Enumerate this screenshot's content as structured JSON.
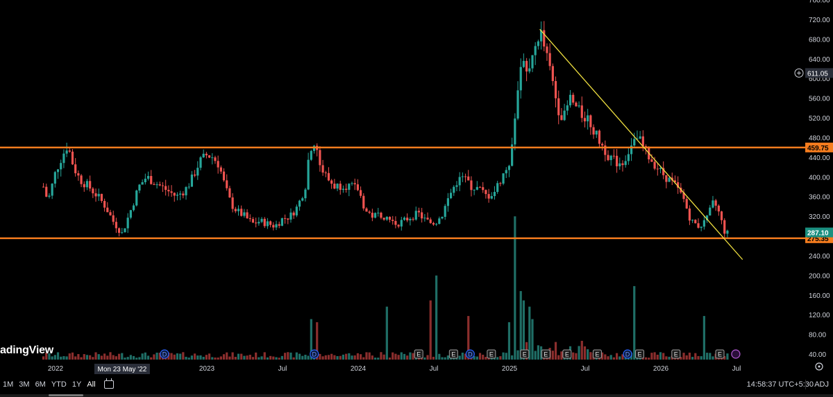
{
  "app": {
    "logo_text": "adingView"
  },
  "chart_data": {
    "type": "candlestick",
    "yticks": [
      40,
      80,
      120,
      160,
      200,
      240,
      280,
      320,
      360,
      400,
      440,
      480,
      520,
      560,
      600,
      640,
      680,
      720,
      760
    ],
    "ytick_labels": [
      "40.00",
      "80.00",
      "120.00",
      "160.00",
      "200.00",
      "240.00",
      "280.00",
      "320.00",
      "360.00",
      "400.00",
      "440.00",
      "480.00",
      "520.00",
      "560.00",
      "600.00",
      "640.00",
      "680.00",
      "720.00",
      "760.00"
    ],
    "xlabels": [
      {
        "t": 0.0,
        "label": "2022"
      },
      {
        "t": 1.0,
        "label": "2023"
      },
      {
        "t": 1.5,
        "label": "Jul"
      },
      {
        "t": 2.0,
        "label": "2024"
      },
      {
        "t": 2.5,
        "label": "Jul"
      },
      {
        "t": 3.0,
        "label": "2025"
      },
      {
        "t": 3.5,
        "label": "Jul"
      },
      {
        "t": 4.0,
        "label": "2026"
      },
      {
        "t": 4.5,
        "label": "Jul"
      }
    ],
    "hover_date": "Mon 23 May '22",
    "close_path": [
      [
        -0.08,
        380
      ],
      [
        -0.05,
        350
      ],
      [
        0.0,
        410
      ],
      [
        0.04,
        440
      ],
      [
        0.08,
        465
      ],
      [
        0.12,
        420
      ],
      [
        0.16,
        395
      ],
      [
        0.22,
        380
      ],
      [
        0.28,
        360
      ],
      [
        0.33,
        340
      ],
      [
        0.38,
        310
      ],
      [
        0.44,
        285
      ],
      [
        0.5,
        335
      ],
      [
        0.55,
        380
      ],
      [
        0.6,
        400
      ],
      [
        0.65,
        390
      ],
      [
        0.7,
        380
      ],
      [
        0.75,
        370
      ],
      [
        0.8,
        360
      ],
      [
        0.86,
        375
      ],
      [
        0.9,
        395
      ],
      [
        0.95,
        430
      ],
      [
        1.0,
        445
      ],
      [
        1.04,
        440
      ],
      [
        1.08,
        425
      ],
      [
        1.12,
        380
      ],
      [
        1.16,
        345
      ],
      [
        1.2,
        330
      ],
      [
        1.25,
        320
      ],
      [
        1.3,
        305
      ],
      [
        1.35,
        310
      ],
      [
        1.4,
        305
      ],
      [
        1.45,
        300
      ],
      [
        1.5,
        315
      ],
      [
        1.55,
        320
      ],
      [
        1.6,
        340
      ],
      [
        1.65,
        380
      ],
      [
        1.68,
        460
      ],
      [
        1.72,
        470
      ],
      [
        1.75,
        420
      ],
      [
        1.8,
        395
      ],
      [
        1.85,
        380
      ],
      [
        1.9,
        385
      ],
      [
        1.95,
        380
      ],
      [
        2.0,
        375
      ],
      [
        2.05,
        330
      ],
      [
        2.1,
        320
      ],
      [
        2.15,
        325
      ],
      [
        2.2,
        315
      ],
      [
        2.25,
        305
      ],
      [
        2.3,
        310
      ],
      [
        2.35,
        320
      ],
      [
        2.4,
        325
      ],
      [
        2.45,
        310
      ],
      [
        2.5,
        305
      ],
      [
        2.55,
        320
      ],
      [
        2.6,
        360
      ],
      [
        2.65,
        390
      ],
      [
        2.7,
        400
      ],
      [
        2.75,
        380
      ],
      [
        2.8,
        375
      ],
      [
        2.85,
        360
      ],
      [
        2.9,
        370
      ],
      [
        2.95,
        400
      ],
      [
        3.0,
        430
      ],
      [
        3.04,
        540
      ],
      [
        3.08,
        640
      ],
      [
        3.12,
        600
      ],
      [
        3.16,
        650
      ],
      [
        3.2,
        700
      ],
      [
        3.24,
        650
      ],
      [
        3.28,
        600
      ],
      [
        3.32,
        540
      ],
      [
        3.36,
        520
      ],
      [
        3.4,
        560
      ],
      [
        3.44,
        540
      ],
      [
        3.48,
        525
      ],
      [
        3.52,
        520
      ],
      [
        3.56,
        490
      ],
      [
        3.6,
        470
      ],
      [
        3.65,
        445
      ],
      [
        3.7,
        430
      ],
      [
        3.75,
        430
      ],
      [
        3.8,
        460
      ],
      [
        3.85,
        480
      ],
      [
        3.9,
        450
      ],
      [
        3.95,
        430
      ],
      [
        4.0,
        410
      ],
      [
        4.05,
        395
      ],
      [
        4.1,
        380
      ],
      [
        4.15,
        355
      ],
      [
        4.2,
        310
      ],
      [
        4.25,
        300
      ],
      [
        4.3,
        310
      ],
      [
        4.35,
        350
      ],
      [
        4.38,
        330
      ],
      [
        4.42,
        290
      ],
      [
        4.44,
        285
      ]
    ],
    "volume_spikes": [
      {
        "t": 1.69,
        "v": 65
      },
      {
        "t": 2.48,
        "v": 95
      },
      {
        "t": 2.51,
        "v": 135
      },
      {
        "t": 3.0,
        "v": 60
      },
      {
        "t": 3.04,
        "v": 230
      },
      {
        "t": 3.07,
        "v": 110
      },
      {
        "t": 3.09,
        "v": 95
      },
      {
        "t": 3.13,
        "v": 85
      },
      {
        "t": 3.15,
        "v": 65
      },
      {
        "t": 3.83,
        "v": 118
      },
      {
        "t": 4.29,
        "v": 70
      },
      {
        "t": 2.18,
        "v": 85
      },
      {
        "t": 2.72,
        "v": 70
      },
      {
        "t": 1.72,
        "v": 60
      }
    ],
    "events": [
      {
        "t": 0.72,
        "code": "D"
      },
      {
        "t": 1.71,
        "code": "D"
      },
      {
        "t": 2.4,
        "code": "E"
      },
      {
        "t": 2.63,
        "code": "E"
      },
      {
        "t": 2.74,
        "code": "D"
      },
      {
        "t": 2.88,
        "code": "E"
      },
      {
        "t": 3.1,
        "code": "E"
      },
      {
        "t": 3.24,
        "code": "E"
      },
      {
        "t": 3.38,
        "code": "E"
      },
      {
        "t": 3.58,
        "code": "E"
      },
      {
        "t": 3.78,
        "code": "D"
      },
      {
        "t": 3.86,
        "code": "E"
      },
      {
        "t": 4.1,
        "code": "E"
      },
      {
        "t": 4.39,
        "code": "E"
      }
    ],
    "hlines": [
      {
        "value": 459.75,
        "label": "459.75",
        "color": "#f57c1e"
      },
      {
        "value": 275.35,
        "label": "275.35",
        "color": "#f57c1e"
      }
    ],
    "trendline": {
      "from": [
        3.2,
        700
      ],
      "to": [
        4.54,
        232
      ],
      "color": "#f0e040"
    },
    "last_price": {
      "value": 287.1,
      "label": "287.10",
      "color": "#1a8f80"
    },
    "crosshair_price": {
      "value": 611.05,
      "label": "611.05"
    },
    "colors": {
      "up": "#26a69a",
      "down": "#ef5350",
      "vol_up": "#1f6e66",
      "vol_down": "#8b2e2d",
      "axis": "#d1d4dc",
      "event_d": "#2962ff",
      "event_e": "#9e9e9e"
    }
  },
  "toolbar": {
    "timeframes": [
      "1M",
      "3M",
      "6M",
      "YTD",
      "1Y",
      "All"
    ],
    "selected": "All",
    "clock": "14:58:37 UTC+5:30",
    "adj": "ADJ"
  }
}
